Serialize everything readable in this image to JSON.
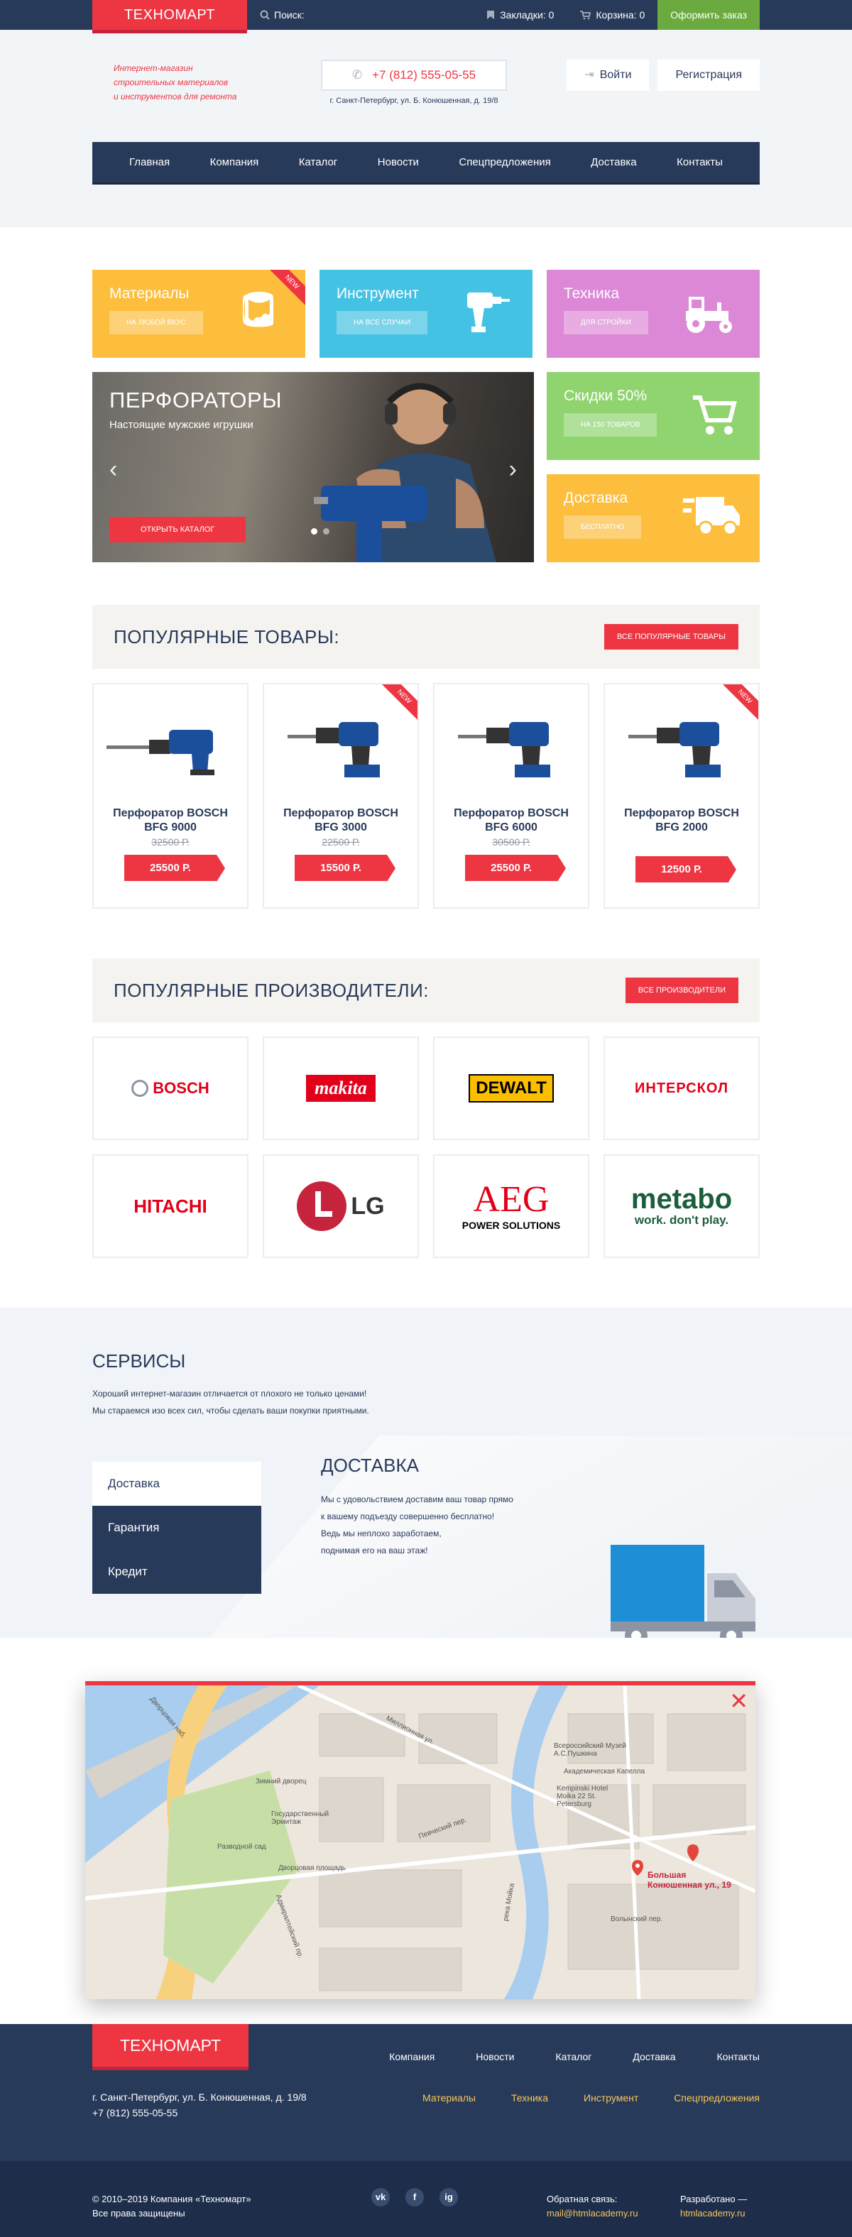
{
  "topbar": {
    "logo": "ТЕХНОМАРТ",
    "search_label": "Поиск:",
    "bookmarks": "Закладки: 0",
    "cart": "Корзина: 0",
    "order": "Оформить заказ"
  },
  "header": {
    "tagline": [
      "Интернет-магазин",
      "строительных материалов",
      "и инструментов для ремонта"
    ],
    "phone": "+7 (812) 555-05-55",
    "address": "г. Санкт-Петербург, ул. Б. Конюшенная, д. 19/8",
    "login": "Войти",
    "register": "Регистрация"
  },
  "nav": [
    "Главная",
    "Компания",
    "Каталог",
    "Новости",
    "Спецпредложения",
    "Доставка",
    "Контакты"
  ],
  "tiles": [
    {
      "title": "Материалы",
      "tag": "На любой вкус",
      "color": "#fdbe3d",
      "icon": "paint-bucket-icon",
      "new": "NEW"
    },
    {
      "title": "Инструмент",
      "tag": "На все случаи",
      "color": "#44c2e3",
      "icon": "drill-icon"
    },
    {
      "title": "Техника",
      "tag": "Для стройки",
      "color": "#dd88d6",
      "icon": "tractor-icon"
    },
    {
      "title": "Скидки 50%",
      "tag": "На 150 товаров",
      "color": "#8fd46f",
      "icon": "cart-icon"
    },
    {
      "title": "Доставка",
      "tag": "Бесплатно",
      "color": "#fdbe3d",
      "icon": "truck-icon"
    }
  ],
  "slider": {
    "title": "ПЕРФОРАТОРЫ",
    "subtitle": "Настоящие мужские игрушки",
    "button": "Открыть каталог",
    "prev": "‹",
    "next": "›"
  },
  "popular": {
    "title": "ПОПУЛЯРНЫЕ ТОВАРЫ:",
    "button": "Все популярные товары",
    "new_label": "NEW",
    "items": [
      {
        "name": "Перфоратор BOSCH BFG 9000",
        "old": "32500 Р.",
        "price": "25500 Р."
      },
      {
        "name": "Перфоратор BOSCH BFG 3000",
        "old": "22500 Р.",
        "price": "15500 Р."
      },
      {
        "name": "Перфоратор BOSCH BFG 6000",
        "old": "30500 Р.",
        "price": "25500 Р."
      },
      {
        "name": "Перфоратор BOSCH BFG 2000",
        "old": "",
        "price": "12500 Р."
      }
    ]
  },
  "brands": {
    "title": "ПОПУЛЯРНЫЕ ПРОИЗВОДИТЕЛИ:",
    "button": "Все производители",
    "items": [
      "BOSCH",
      "makita",
      "DEWALT",
      "ИНТЕРСКОЛ",
      "HITACHI",
      "LG",
      "AEG",
      "metabo"
    ],
    "aeg_sub": "POWER SOLUTIONS",
    "metabo_sub": "work. don't play."
  },
  "services": {
    "title": "СЕРВИСЫ",
    "intro": [
      "Хороший интернет-магазин отличается от плохого не только ценами!",
      "Мы стараемся изо всех сил, чтобы сделать ваши покупки приятными."
    ],
    "tabs": [
      "Доставка",
      "Гарантия",
      "Кредит"
    ],
    "content_title": "ДОСТАВКА",
    "content_lines": [
      "Мы с удовольствием доставим ваш товар прямо",
      "к вашему подъезду совершенно бесплатно!",
      "Ведь мы неплохо заработаем,",
      "поднимая его на ваш этаж!"
    ]
  },
  "map": {
    "close": "✕",
    "pin_label": [
      "Большая",
      "Конюшенная ул., 19"
    ],
    "labels": [
      "Зимний дворец",
      "Государственный Эрмитаж",
      "Разводной сад",
      "Дворцовая площадь",
      "Всероссийский Музей А.С.Пушкина",
      "Академическая Капелла",
      "Kempinski Hotel Moika 22 St. Petersburg",
      "Дворцовая наб.",
      "Миллионная ул.",
      "Волынский пер.",
      "Певческий пер.",
      "река Мойка",
      "Адмиралтейский пр."
    ]
  },
  "footer": {
    "logo": "ТЕХНОМАРТ",
    "nav": [
      "Компания",
      "Новости",
      "Каталог",
      "Доставка",
      "Контакты"
    ],
    "cats": [
      "Материалы",
      "Техника",
      "Инструмент",
      "Спецпредложения"
    ],
    "address": "г. Санкт-Петербург, ул. Б. Конюшенная, д. 19/8",
    "phone": "+7 (812) 555-05-55",
    "copy": [
      "© 2010–2019 Компания «Техномарт»",
      "Все права защищены"
    ],
    "feedback_label": "Обратная связь:",
    "feedback_mail": "mail@htmlacademy.ru",
    "dev_label": "Разработано —",
    "dev_site": "htmlacademy.ru",
    "social": [
      "vk",
      "f",
      "ig"
    ]
  }
}
